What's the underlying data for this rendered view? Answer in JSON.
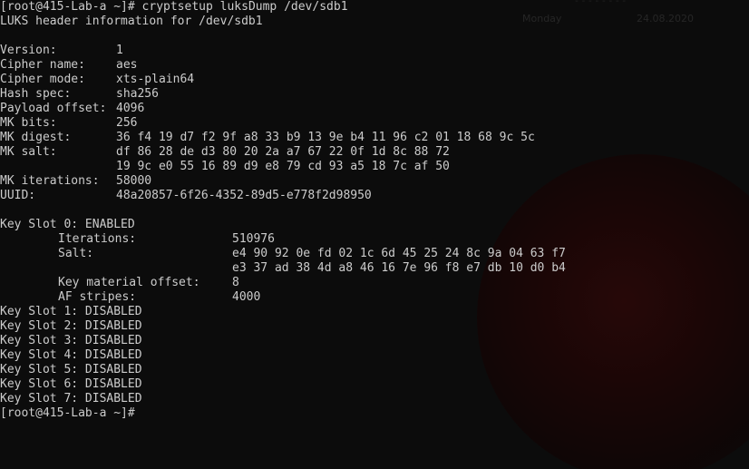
{
  "wallpaper": {
    "day": "Monday",
    "date": "24.08.2020",
    "top": "- - - - - - - -"
  },
  "prompt": "[root@415-Lab-a ~]#",
  "command": "cryptsetup luksDump /dev/sdb1",
  "header_line": "LUKS header information for /dev/sdb1",
  "fields": [
    {
      "label": "Version:",
      "value": "1"
    },
    {
      "label": "Cipher name:",
      "value": "aes"
    },
    {
      "label": "Cipher mode:",
      "value": "xts-plain64"
    },
    {
      "label": "Hash spec:",
      "value": "sha256"
    },
    {
      "label": "Payload offset:",
      "value": "4096"
    },
    {
      "label": "MK bits:",
      "value": "256"
    },
    {
      "label": "MK digest:",
      "value": "36 f4 19 d7 f2 9f a8 33 b9 13 9e b4 11 96 c2 01 18 68 9c 5c"
    },
    {
      "label": "MK salt:",
      "value": "df 86 28 de d3 80 20 2a a7 67 22 0f 1d 8c 88 72"
    },
    {
      "label": "",
      "value": "19 9c e0 55 16 89 d9 e8 79 cd 93 a5 18 7c af 50"
    },
    {
      "label": "MK iterations:",
      "value": "58000"
    },
    {
      "label": "UUID:",
      "value": "48a20857-6f26-4352-89d5-e778f2d98950"
    }
  ],
  "key_slot_0": {
    "title": "Key Slot 0: ENABLED",
    "rows": [
      {
        "label": "Iterations:",
        "value": "510976"
      },
      {
        "label": "Salt:",
        "value": "e4 90 92 0e fd 02 1c 6d 45 25 24 8c 9a 04 63 f7"
      },
      {
        "label": "",
        "value": "e3 37 ad 38 4d a8 46 16 7e 96 f8 e7 db 10 d0 b4"
      },
      {
        "label": "Key material offset:",
        "value": "8"
      },
      {
        "label": "AF stripes:",
        "value": "4000"
      }
    ]
  },
  "disabled_slots": [
    "Key Slot 1: DISABLED",
    "Key Slot 2: DISABLED",
    "Key Slot 3: DISABLED",
    "Key Slot 4: DISABLED",
    "Key Slot 5: DISABLED",
    "Key Slot 6: DISABLED",
    "Key Slot 7: DISABLED"
  ]
}
